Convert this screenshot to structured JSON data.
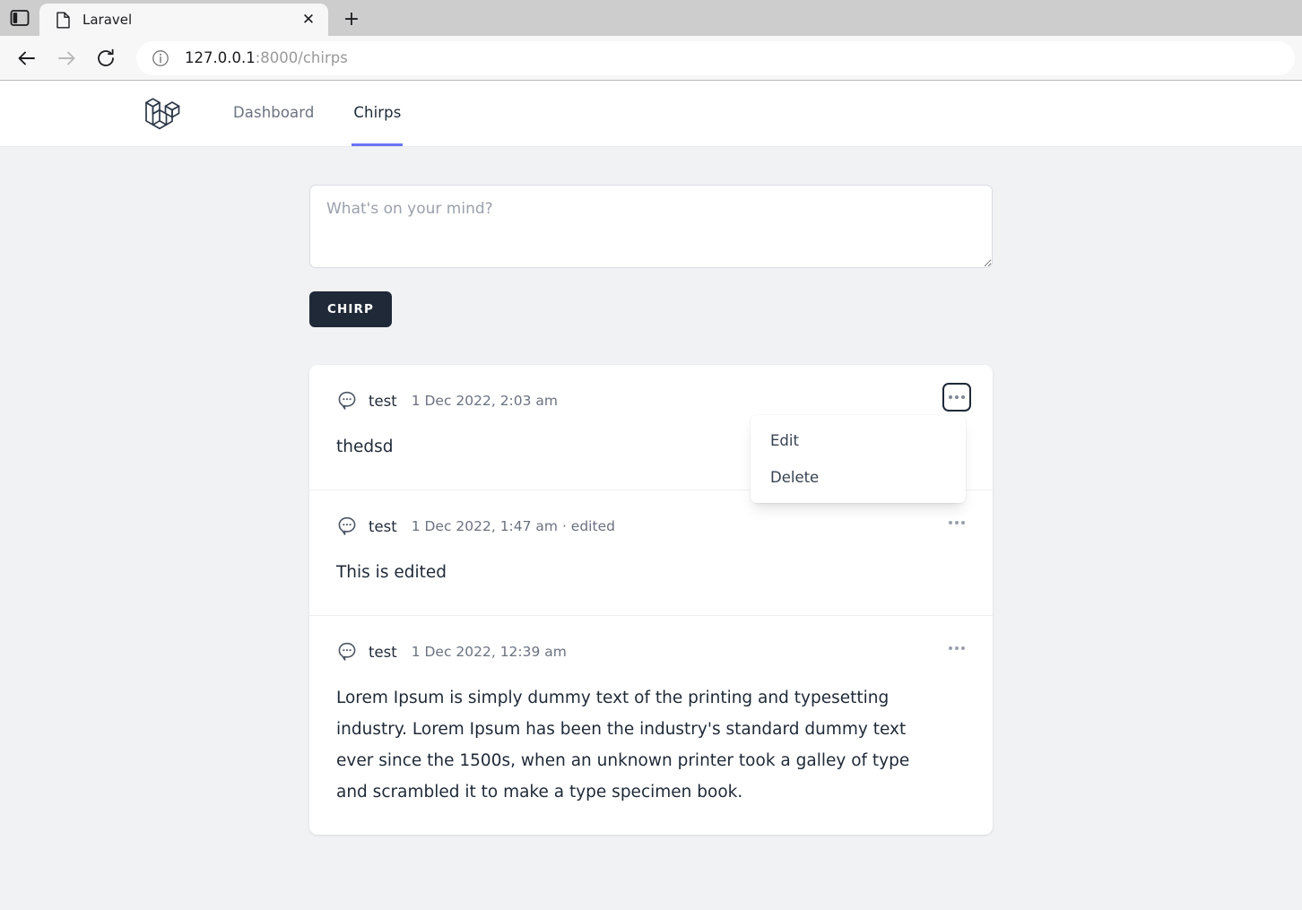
{
  "browser": {
    "panel_toggle_icon": "sidebar-panel-icon",
    "tab": {
      "title": "Laravel",
      "favicon_icon": "page-file-icon",
      "close_icon": "close-icon"
    },
    "new_tab_icon": "plus-icon",
    "back_icon": "arrow-left-icon",
    "forward_icon": "arrow-right-icon",
    "reload_icon": "reload-icon",
    "url": {
      "info_icon": "info-circle-icon",
      "host": "127.0.0.1",
      "rest": ":8000/chirps",
      "full": "127.0.0.1:8000/chirps"
    }
  },
  "app": {
    "brand_icon": "laravel-logo-icon",
    "nav_links": [
      {
        "label": "Dashboard",
        "active": false
      },
      {
        "label": "Chirps",
        "active": true
      }
    ],
    "accent_color": "#6875f5",
    "composer": {
      "placeholder": "What's on your mind?",
      "value": "",
      "submit_label": "CHIRP",
      "submit_color": "#1f2937"
    },
    "chirps": [
      {
        "author": "test",
        "meta": "1 Dec 2022, 2:03 am",
        "body": "thedsd",
        "menu_open": true,
        "menu_items": [
          {
            "label": "Edit"
          },
          {
            "label": "Delete"
          }
        ]
      },
      {
        "author": "test",
        "meta": "1 Dec 2022, 1:47 am · edited",
        "body": "This is edited",
        "menu_open": false
      },
      {
        "author": "test",
        "meta": "1 Dec 2022, 12:39 am",
        "body": "Lorem Ipsum is simply dummy text of the printing and typesetting industry. Lorem Ipsum has been the industry's standard dummy text ever since the 1500s, when an unknown printer took a galley of type and scrambled it to make a type specimen book.",
        "menu_open": false
      }
    ]
  }
}
